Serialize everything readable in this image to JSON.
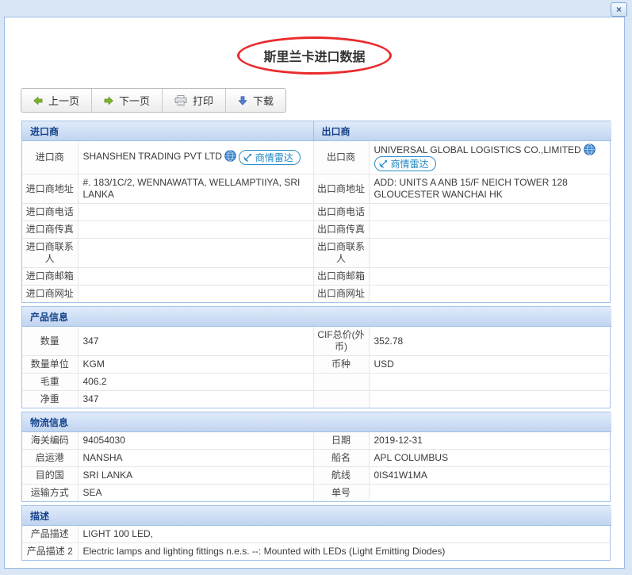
{
  "window": {
    "close_icon": "×"
  },
  "page": {
    "title": "斯里兰卡进口数据"
  },
  "toolbar": {
    "prev_label": "上一页",
    "next_label": "下一页",
    "print_label": "打印",
    "download_label": "下载"
  },
  "badges": {
    "radar_label": "商情雷达"
  },
  "importer": {
    "header": "进口商",
    "name_label": "进口商",
    "name": "SHANSHEN TRADING PVT LTD",
    "fields": [
      {
        "label": "进口商地址",
        "value": "#. 183/1C/2, WENNAWATTA, WELLAMPTIIYA, SRI LANKA"
      },
      {
        "label": "进口商电话",
        "value": ""
      },
      {
        "label": "进口商传真",
        "value": ""
      },
      {
        "label": "进口商联系人",
        "value": ""
      },
      {
        "label": "进口商邮箱",
        "value": ""
      },
      {
        "label": "进口商网址",
        "value": ""
      }
    ]
  },
  "exporter": {
    "header": "出口商",
    "name_label": "出口商",
    "name": "UNIVERSAL GLOBAL LOGISTICS CO.,LIMITED",
    "fields": [
      {
        "label": "出口商地址",
        "value": "ADD: UNITS A ANB 15/F NEICH TOWER 128 GLOUCESTER WANCHAI HK"
      },
      {
        "label": "出口商电话",
        "value": ""
      },
      {
        "label": "出口商传真",
        "value": ""
      },
      {
        "label": "出口商联系人",
        "value": ""
      },
      {
        "label": "出口商邮箱",
        "value": ""
      },
      {
        "label": "出口商网址",
        "value": ""
      }
    ]
  },
  "product": {
    "header": "产品信息",
    "rows": [
      {
        "l_label": "数量",
        "l_value": "347",
        "r_label": "CIF总价(外币)",
        "r_value": "352.78"
      },
      {
        "l_label": "数量单位",
        "l_value": "KGM",
        "r_label": "币种",
        "r_value": "USD"
      },
      {
        "l_label": "毛重",
        "l_value": "406.2",
        "r_label": "",
        "r_value": ""
      },
      {
        "l_label": "净重",
        "l_value": "347",
        "r_label": "",
        "r_value": ""
      }
    ]
  },
  "logistics": {
    "header": "物流信息",
    "rows": [
      {
        "l_label": "海关编码",
        "l_value": "94054030",
        "r_label": "日期",
        "r_value": "2019-12-31"
      },
      {
        "l_label": "启运港",
        "l_value": "NANSHA",
        "r_label": "船名",
        "r_value": "APL COLUMBUS"
      },
      {
        "l_label": "目的国",
        "l_value": "SRI LANKA",
        "r_label": "航线",
        "r_value": "0IS41W1MA"
      },
      {
        "l_label": "运输方式",
        "l_value": "SEA",
        "r_label": "单号",
        "r_value": ""
      }
    ]
  },
  "description": {
    "header": "描述",
    "rows": [
      {
        "label": "产品描述",
        "value": "LIGHT 100 LED,"
      },
      {
        "label": "产品描述 2",
        "value": "Electric lamps and lighting fittings n.e.s. --: Mounted with LEDs (Light Emitting Diodes)"
      }
    ]
  },
  "colors": {
    "accent_blue": "#15428b",
    "circle_red": "#ea2a2c",
    "radar_blue": "#1f87c5"
  }
}
